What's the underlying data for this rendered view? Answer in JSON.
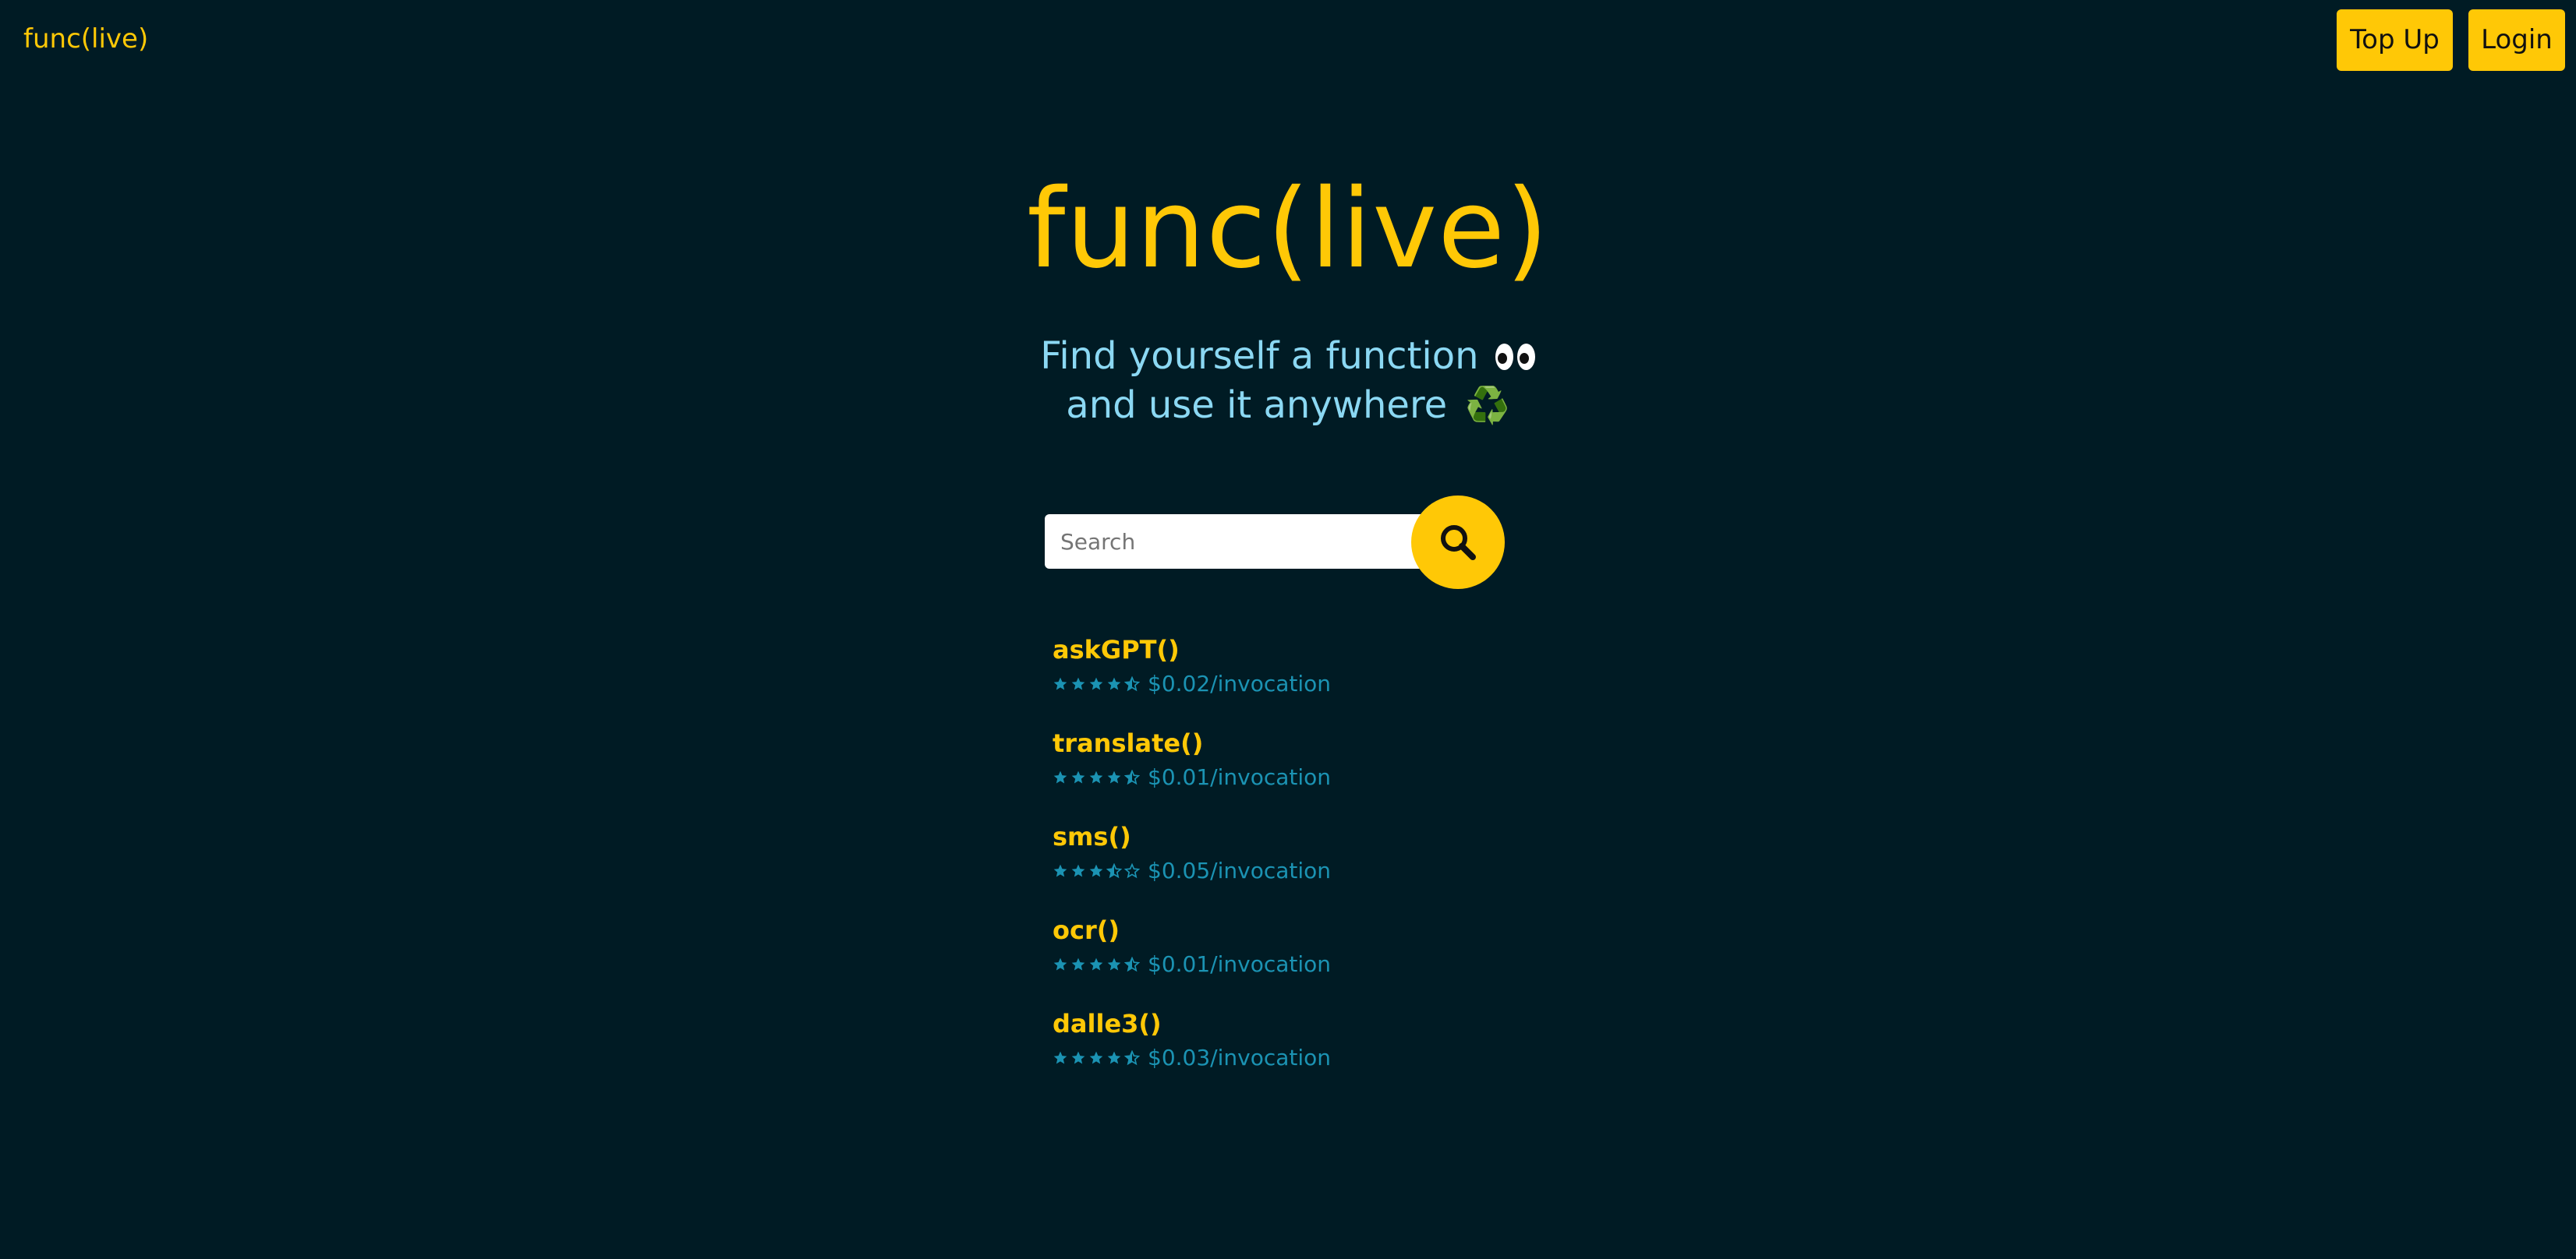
{
  "header": {
    "logo": "func(live)",
    "topup_label": "Top Up",
    "login_label": "Login"
  },
  "hero": {
    "title": "func(live)",
    "subtitle_line1": "Find yourself a function",
    "subtitle_line1_emoji": "eyes-emoji",
    "subtitle_line2": "and use it anywhere",
    "subtitle_line2_emoji": "♻️"
  },
  "search": {
    "placeholder": "Search",
    "value": "",
    "button_icon": "search-icon"
  },
  "functions": [
    {
      "name": "askGPT()",
      "rating": 4.5,
      "price": "$0.02/invocation"
    },
    {
      "name": "translate()",
      "rating": 4.5,
      "price": "$0.01/invocation"
    },
    {
      "name": "sms()",
      "rating": 3.5,
      "price": "$0.05/invocation"
    },
    {
      "name": "ocr()",
      "rating": 4.5,
      "price": "$0.01/invocation"
    },
    {
      "name": "dalle3()",
      "rating": 4.5,
      "price": "$0.03/invocation"
    }
  ],
  "colors": {
    "background": "#001b24",
    "accent": "#ffc806",
    "subtitle": "#8bd8f3",
    "muted_teal": "#1b93b3"
  }
}
